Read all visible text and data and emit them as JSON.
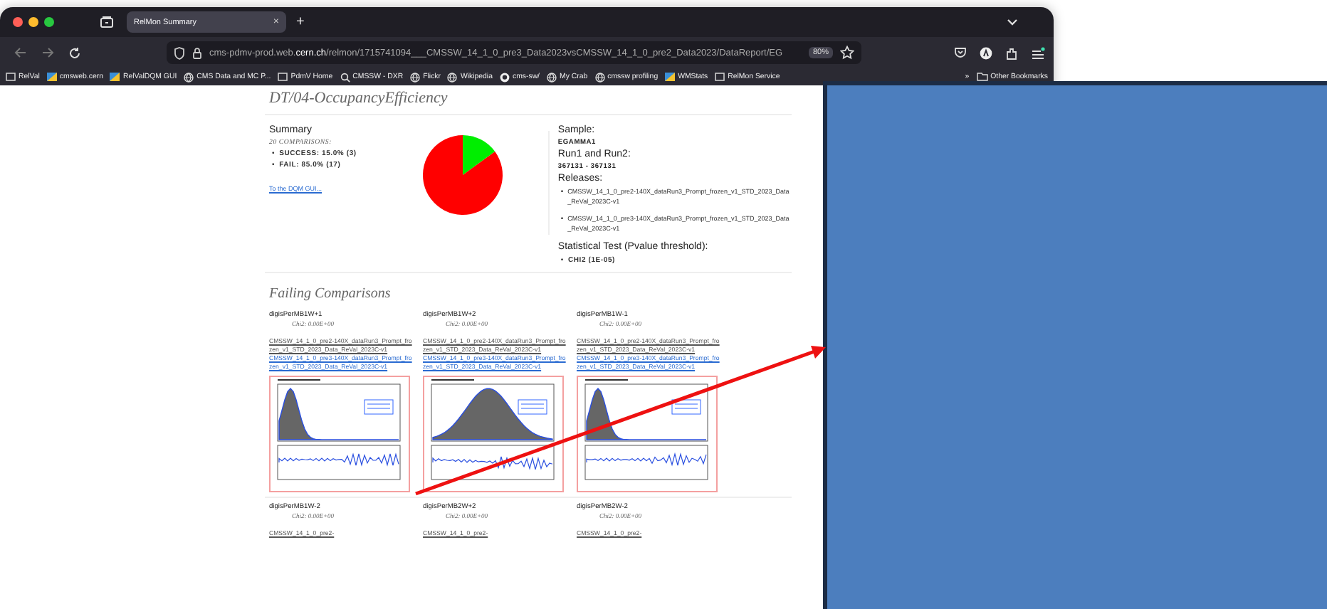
{
  "browser": {
    "tab": {
      "title": "RelMon Summary",
      "close": "×",
      "selected": true
    },
    "new_tab": "+",
    "url": "cms-pdmv-prod.web.**cern.ch**/relmon/1715741094___CMSSW_14_1_0_pre3_Data2023vsCMSSW_14_1_0_pre2_Data2023/DataReport/EG",
    "zoom": "80%",
    "bookmarks": [
      {
        "label": "RelVal",
        "kind": "site"
      },
      {
        "label": "cmsweb.cern",
        "kind": "cms"
      },
      {
        "label": "RelValDQM GUI",
        "kind": "cms"
      },
      {
        "label": "CMS Data and MC P...",
        "kind": "globe"
      },
      {
        "label": "PdmV Home",
        "kind": "site"
      },
      {
        "label": "CMSSW - DXR",
        "kind": "search"
      },
      {
        "label": "Flickr",
        "kind": "globe"
      },
      {
        "label": "Wikipedia",
        "kind": "globe"
      },
      {
        "label": "cms-sw/",
        "kind": "cat"
      },
      {
        "label": "My Crab",
        "kind": "globe"
      },
      {
        "label": "cmssw profiling",
        "kind": "globe"
      },
      {
        "label": "WMStats",
        "kind": "cms"
      },
      {
        "label": "RelMon Service",
        "kind": "site"
      }
    ],
    "overflow": "»",
    "other_bookmarks": "Other Bookmarks"
  },
  "page": {
    "title": "DT/04-OccupancyEfficiency",
    "summary": {
      "title": "Summary",
      "count": "20 COMPARISONS:",
      "bullet": "•",
      "results": [
        "SUCCESS: 15.0% (3)",
        "FAIL: 85.0% (17)"
      ],
      "link": "To the DQM GUI...",
      "chart_data": {
        "type": "pie",
        "values": [
          15,
          85
        ],
        "colors": [
          "#00ee00",
          "#ff0000"
        ]
      }
    },
    "info": {
      "bullet": "•",
      "sample_label": "Sample:",
      "sample": "EGAMMA1",
      "runs_label": "Run1 and Run2:",
      "runs": "367131 - 367131",
      "releases_label": "Releases:",
      "releases": [
        "CMSSW_14_1_0_pre2-140X_dataRun3_Prompt_frozen_v1_STD_2023_Data_ReVal_2023C-v1",
        "CMSSW_14_1_0_pre3-140X_dataRun3_Prompt_frozen_v1_STD_2023_Data_ReVal_2023C-v1"
      ],
      "test_label": "Statistical Test (Pvalue threshold):",
      "test": "CHI2 (1E-05)"
    },
    "failing": {
      "title": "Failing Comparisons",
      "rows": [
        [
          {
            "name": "digisPerMB1W+1",
            "chi2": "Chi2: 0.00E+00",
            "links": [
              {
                "text": "CMSSW_14_1_0_pre2-140X_dataRun3_Prompt_frozen_v1_STD_2023_Data_ReVal_2023C-v1",
                "visited": true
              },
              {
                "text": "CMSSW_14_1_0_pre3-140X_dataRun3_Prompt_frozen_v1_STD_2023_Data_ReVal_2023C-v1",
                "visited": false
              }
            ],
            "plot": {
              "kind": "picture"
            }
          },
          {
            "name": "digisPerMB1W+2",
            "chi2": "Chi2: 0.00E+00",
            "links": [
              {
                "text": "CMSSW_14_1_0_pre2-140X_dataRun3_Prompt_frozen_v1_STD_2023_Data_ReVal_2023C-v1",
                "visited": true
              },
              {
                "text": "CMSSW_14_1_0_pre3-140X_dataRun3_Prompt_frozen_v1_STD_2023_Data_ReVal_2023C-v1",
                "visited": false
              }
            ],
            "plot": {
              "kind": "picture"
            }
          },
          {
            "name": "digisPerMB1W-1",
            "chi2": "Chi2: 0.00E+00",
            "links": [
              {
                "text": "CMSSW_14_1_0_pre2-140X_dataRun3_Prompt_frozen_v1_STD_2023_Data_ReVal_2023C-v1",
                "visited": true
              },
              {
                "text": "CMSSW_14_1_0_pre3-140X_dataRun3_Prompt_frozen_v1_STD_2023_Data_ReVal_2023C-v1",
                "visited": false
              }
            ],
            "plot": {
              "kind": "picture"
            }
          }
        ],
        [
          {
            "name": "digisPerMB1W-2",
            "chi2": "Chi2: 0.00E+00",
            "links": [
              {
                "text": "CMSSW_14_1_0_pre2-",
                "visited": true
              }
            ]
          },
          {
            "name": "digisPerMB2W+2",
            "chi2": "Chi2: 0.00E+00",
            "links": [
              {
                "text": "CMSSW_14_1_0_pre2-",
                "visited": true
              }
            ]
          },
          {
            "name": "digisPerMB2W-2",
            "chi2": "Chi2: 0.00E+00",
            "links": [
              {
                "text": "CMSSW_14_1_0_pre2-",
                "visited": true
              }
            ]
          }
        ]
      ]
    }
  }
}
